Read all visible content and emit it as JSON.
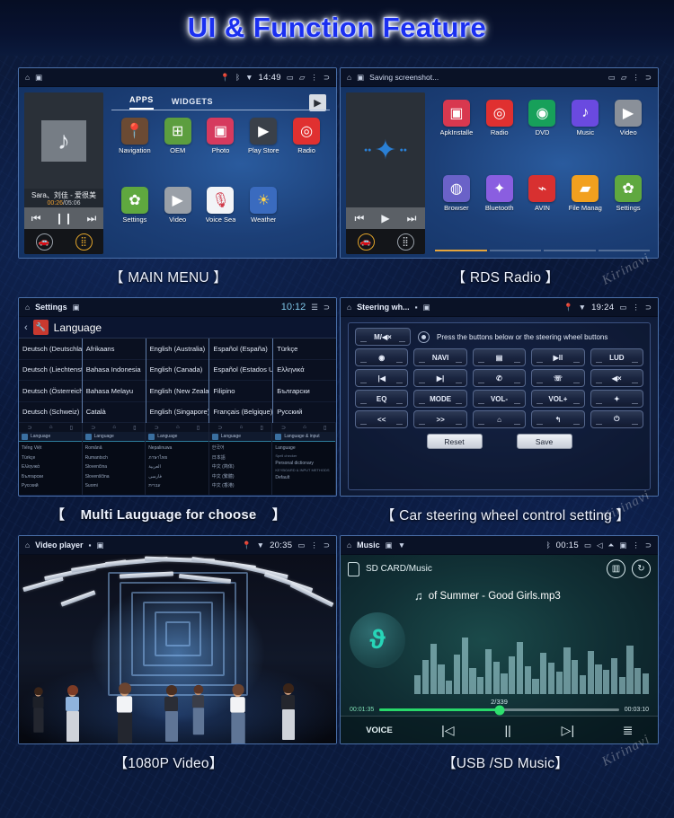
{
  "header": {
    "title": "UI  & Function Feature",
    "accent": "#1a2ff0"
  },
  "watermark": "Kirinavi",
  "panels": {
    "main_menu": {
      "caption": "【 MAIN MENU 】",
      "statusbar": {
        "home": "home-icon",
        "screenshot": "image-icon",
        "location": "location-icon",
        "bluetooth": "bluetooth-icon",
        "wifi": "wifi-icon",
        "time": "14:49",
        "battery": "battery-icon",
        "recent": "recent-icon",
        "menu": "menu-icon",
        "back": "back-icon"
      },
      "widget": {
        "art": "music-note",
        "title": "Sara、刘佳 - 爱很美",
        "elapsed": "00:26",
        "separator": "/",
        "duration": "05:06",
        "prev": "prev-icon",
        "pause": "pause-icon",
        "next": "next-icon",
        "car": "car-icon",
        "apps": "apps-icon"
      },
      "tabs": [
        {
          "label": "APPS",
          "active": true
        },
        {
          "label": "WIDGETS",
          "active": false
        }
      ],
      "store": "play-store-icon",
      "apps": [
        {
          "label": "Navigation",
          "icon": "pin-icon",
          "color": "#6b4a33",
          "glyph": "◉"
        },
        {
          "label": "OEM",
          "icon": "android-icon",
          "color": "#5c9e3f",
          "glyph": "⌘"
        },
        {
          "label": "Photo",
          "icon": "photo-icon",
          "color": "#d63a5e",
          "glyph": "◩"
        },
        {
          "label": "Play Store",
          "icon": "play-store-icon",
          "color": "#3a4049",
          "glyph": "▶"
        },
        {
          "label": "Radio",
          "icon": "radio-icon",
          "color": "#e03030",
          "glyph": "◎"
        },
        {
          "label": "Settings",
          "icon": "gear-icon",
          "color": "#5fa83f",
          "glyph": "✿"
        },
        {
          "label": "Video",
          "icon": "video-icon",
          "color": "#9aa0a8",
          "glyph": "▶"
        },
        {
          "label": "Voice Sea",
          "icon": "microphone-icon",
          "color": "#f2f4f7",
          "glyph": "🎤"
        },
        {
          "label": "Weather",
          "icon": "weather-icon",
          "color": "#3a6bbf",
          "glyph": "☀"
        }
      ]
    },
    "rds_radio": {
      "caption": "【 RDS Radio 】",
      "statusbar": {
        "home": "home-icon",
        "notice": "Saving screenshot...",
        "battery": "battery-icon",
        "recent": "recent-icon",
        "menu": "menu-icon",
        "back": "back-icon"
      },
      "widget": {
        "art": "bluetooth-icon",
        "prev": "prev-icon",
        "play": "play-icon",
        "next": "next-icon",
        "car": "car-icon",
        "apps": "apps-icon"
      },
      "apps": [
        {
          "label": "ApkInstalle",
          "icon": "apk-install-icon",
          "color": "#d8384f",
          "glyph": "▣"
        },
        {
          "label": "Radio",
          "icon": "radio-icon",
          "color": "#e03030",
          "glyph": "◎"
        },
        {
          "label": "DVD",
          "icon": "disc-icon",
          "color": "#17a05a",
          "glyph": "◉"
        },
        {
          "label": "Music",
          "icon": "music-note-icon",
          "color": "#6a4ae0",
          "glyph": "♪"
        },
        {
          "label": "Video",
          "icon": "video-icon",
          "color": "#8a9099",
          "glyph": "▶"
        },
        {
          "label": "Browser",
          "icon": "globe-icon",
          "color": "#6a62c8",
          "glyph": "🌐"
        },
        {
          "label": "Bluetooth",
          "icon": "bluetooth-icon",
          "color": "#8a5ee0",
          "glyph": "✦"
        },
        {
          "label": "AVIN",
          "icon": "avin-icon",
          "color": "#d83030",
          "glyph": "⌁"
        },
        {
          "label": "File Manag",
          "icon": "folder-icon",
          "color": "#f2a01e",
          "glyph": "▰"
        },
        {
          "label": "Settings",
          "icon": "gear-icon",
          "color": "#5fa83f",
          "glyph": "✿"
        }
      ],
      "pager": [
        true,
        false,
        false,
        false
      ]
    },
    "language": {
      "caption_open": "【",
      "caption": "Multi Lauguage for choose",
      "caption_close": "】",
      "statusbar": {
        "home": "home-icon",
        "title": "Settings",
        "screenshot": "image-icon",
        "time": "10:12",
        "list": "list-icon",
        "back": "back-icon"
      },
      "subheader": {
        "back_chevron": "chevron-left-icon",
        "icon": "wrench-icon",
        "label": "Language"
      },
      "columns": [
        [
          "Deutsch (Deutschland)",
          "Deutsch (Liechtenstein)",
          "Deutsch (Österreich)",
          "Deutsch (Schweiz)"
        ],
        [
          "Afrikaans",
          "Bahasa Indonesia",
          "Bahasa Melayu",
          "Català"
        ],
        [
          "English (Australia)",
          "English (Canada)",
          "English (New Zealand)",
          "English (Singapore)"
        ],
        [
          "Español (España)",
          "Español (Estados Unidos)",
          "Filipino",
          "Français (Belgique)"
        ],
        [
          "Türkçe",
          "Ελληνικά",
          "Български",
          "Русский"
        ]
      ],
      "thumbs": [
        {
          "title": "Language",
          "rows": [
            "Tiếng Việt",
            "Türkçe",
            "Ελληνικά",
            "Български",
            "Русский"
          ]
        },
        {
          "title": "Language",
          "rows": [
            "Română",
            "Rumantsch",
            "Slovenčina",
            "Slovenščina",
            "Suomi"
          ]
        },
        {
          "title": "Language",
          "rows": [
            "Nepalinuwa",
            "ภาษาไทย",
            "العربية",
            "فارسی",
            "עברית"
          ]
        },
        {
          "title": "Language",
          "rows": [
            "한국어",
            "日本語",
            "中文 (简体)",
            "中文 (繁體)",
            "中文 (香港)"
          ]
        },
        {
          "title": "Language & input",
          "rows": [
            "Language",
            "Spell checker",
            "Personal dictionary",
            "KEYBOARD & INPUT METHODS",
            "Default"
          ]
        }
      ]
    },
    "steering": {
      "caption": "【 Car steering wheel control setting 】",
      "statusbar": {
        "home": "home-icon",
        "title": "Steering wh...",
        "screenshot": "image-icon",
        "location": "location-icon",
        "wifi": "wifi-icon",
        "time": "19:24",
        "battery": "battery-icon",
        "menu": "menu-icon",
        "back": "back-icon"
      },
      "mute_button": "M/◀×",
      "hint": "Press the buttons below or the steering wheel buttons",
      "rows": [
        [
          {
            "label": "◉",
            "name": "record-button"
          },
          {
            "label": "NAVI",
            "name": "navi-button"
          },
          {
            "label": "▤",
            "name": "source-button"
          },
          {
            "label": "▶ll",
            "name": "play-pause-button"
          },
          {
            "label": "LUD",
            "name": "lud-button"
          }
        ],
        [
          {
            "label": "|◀",
            "name": "previous-button"
          },
          {
            "label": "▶|",
            "name": "next-button"
          },
          {
            "label": "✆",
            "name": "call-button"
          },
          {
            "label": "☏",
            "name": "hangup-button"
          },
          {
            "label": "◀×",
            "name": "mute-button"
          }
        ],
        [
          {
            "label": "EQ",
            "name": "eq-button"
          },
          {
            "label": "MODE",
            "name": "mode-button"
          },
          {
            "label": "VOL-",
            "name": "volume-down-button"
          },
          {
            "label": "VOL+",
            "name": "volume-up-button"
          },
          {
            "label": "✦",
            "name": "bluetooth-button"
          }
        ],
        [
          {
            "label": "<<",
            "name": "rewind-button"
          },
          {
            "label": ">>",
            "name": "forward-button"
          },
          {
            "label": "⌂",
            "name": "home-button"
          },
          {
            "label": "↰",
            "name": "back-button"
          },
          {
            "label": "⏻",
            "name": "power-button"
          }
        ]
      ],
      "reset": "Reset",
      "save": "Save"
    },
    "video": {
      "caption": "【1080P Video】",
      "statusbar": {
        "home": "home-icon",
        "title": "Video player",
        "sd": "sd-icon",
        "screenshot": "image-icon",
        "location": "location-icon",
        "wifi": "wifi-icon",
        "time": "20:35",
        "battery": "battery-icon",
        "menu": "menu-icon",
        "back": "back-icon"
      }
    },
    "music": {
      "caption": "【USB /SD Music】",
      "statusbar": {
        "home": "home-icon",
        "title": "Music",
        "screenshot": "image-icon",
        "wifi": "wifi-icon",
        "bluetooth": "bluetooth-icon",
        "time": "00:15",
        "battery": "battery-icon",
        "volume": "volume-icon",
        "eject": "eject-icon",
        "picture": "picture-icon",
        "menu": "menu-icon",
        "back": "back-icon"
      },
      "path": "SD CARD/Music",
      "eq_button": "equalizer-icon",
      "repeat_button": "repeat-icon",
      "album_art": "music-logo-icon",
      "note_icon": "music-note-icon",
      "track_title": "of Summer - Good Girls.mp3",
      "track_index": "2/339",
      "elapsed": "00:01:35",
      "duration": "00:03:10",
      "progress_percent": 50,
      "controls": {
        "voice": "VOICE",
        "prev": "|◁",
        "pause": "||",
        "next": "▷|",
        "playlist": "playlist-icon"
      }
    }
  }
}
